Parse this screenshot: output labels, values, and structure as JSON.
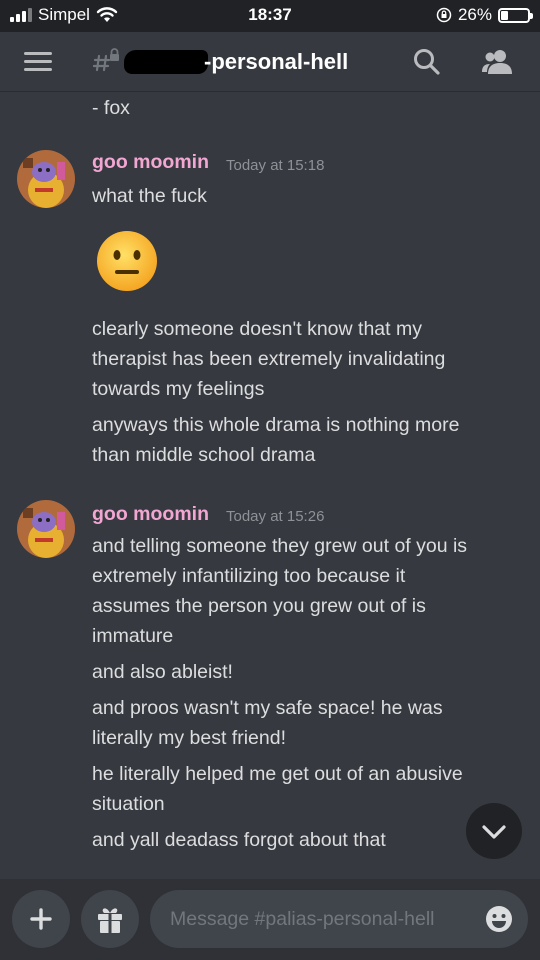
{
  "status_bar": {
    "carrier": "Simpel",
    "time": "18:37",
    "battery": "26%",
    "battery_fraction": 0.26
  },
  "header": {
    "channel_name": "-personal-hell",
    "icons": [
      "menu-icon",
      "locked-channel-icon",
      "search-icon",
      "members-icon"
    ]
  },
  "messages": {
    "top_fragment": "- fox",
    "groups": [
      {
        "username": "goo moomin",
        "timestamp": "Today at 15:18",
        "lines": [
          "what the fuck",
          "clearly someone doesn't know that my",
          "therapist has been extremely invalidating",
          "towards my feelings",
          "anyways this whole drama is nothing more",
          "than middle school drama"
        ],
        "emoji": "neutral-face"
      },
      {
        "username": "goo moomin",
        "timestamp": "Today at 15:26",
        "lines": [
          "and telling someone they grew out of you is",
          "extremely infantilizing too because it",
          "assumes the person you grew out of is",
          "immature",
          "and also ableist!",
          "and proos wasn't my safe space! he was",
          "literally my best friend!",
          "he literally helped me get out of an abusive",
          "situation",
          "and yall deadass forgot about that"
        ]
      }
    ]
  },
  "composer": {
    "placeholder": "Message #palias-personal-hell"
  },
  "colors": {
    "background": "#36393f",
    "username": "#f2a6d2",
    "composer_bg": "#2f3136",
    "input_bg": "#40444b"
  }
}
